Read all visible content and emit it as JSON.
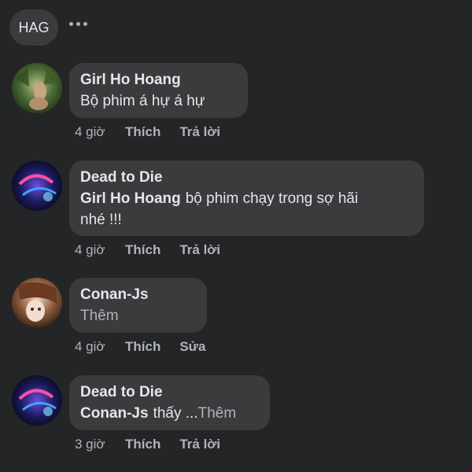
{
  "header": {
    "chip_label": "HAG",
    "more_icon": "more-horizontal-icon"
  },
  "comments": [
    {
      "author": "Girl Ho Hoang",
      "text": "Bộ phim á hự á hự",
      "time": "4 giờ",
      "actions": [
        "Thích",
        "Trả lời"
      ]
    },
    {
      "author": "Dead to Die",
      "mention": "Girl Ho Hoang",
      "text_line1": "bộ phim chạy trong sợ hãi",
      "text_line2": "nhé !!!",
      "time": "4 giờ",
      "actions": [
        "Thích",
        "Trả lời"
      ]
    },
    {
      "author": "Conan-Js",
      "text": "Thêm",
      "time": "4 giờ",
      "actions": [
        "Thích",
        "Sửa"
      ]
    },
    {
      "author": "Dead to Die",
      "mention": "Conan-Js",
      "text": "thấy ...",
      "more_label": "Thêm",
      "time": "3 giờ",
      "actions": [
        "Thích",
        "Trả lời"
      ]
    }
  ],
  "colors": {
    "background": "#242526",
    "bubble": "#3a3b3c",
    "text": "#e4e6eb",
    "secondary": "#b0b3b8"
  }
}
